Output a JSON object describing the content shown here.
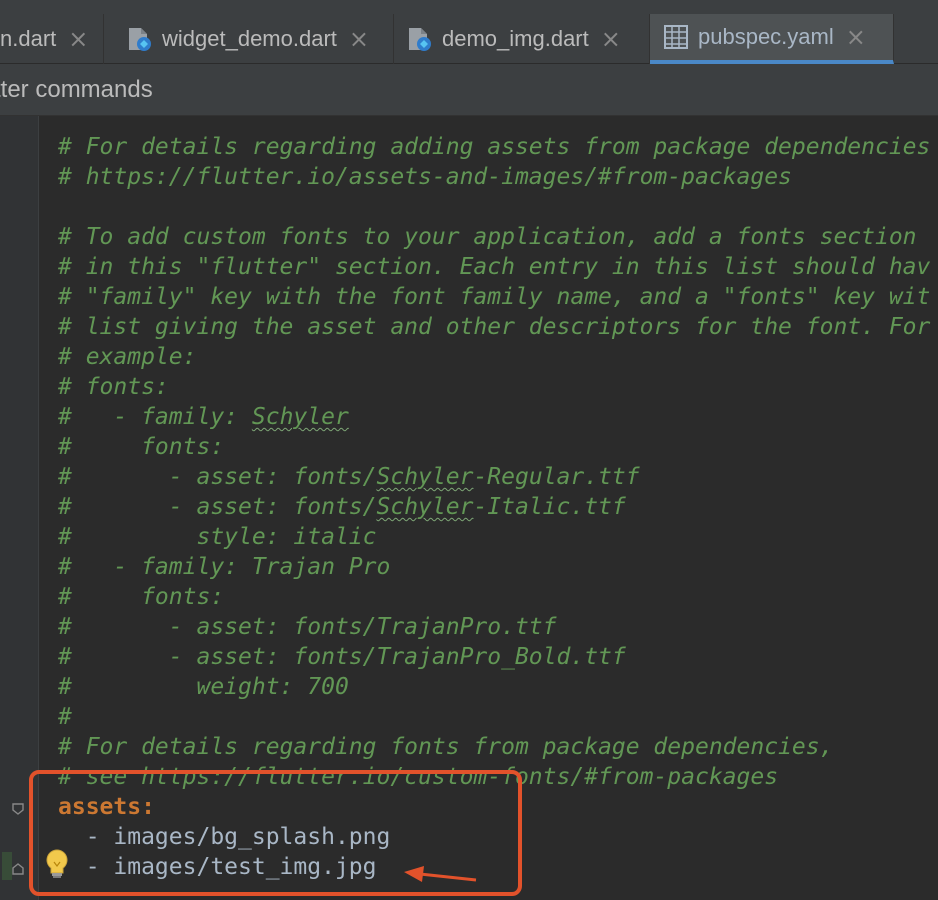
{
  "tabs": [
    {
      "label": "n.dart",
      "icon": "dart-file-icon",
      "active": false
    },
    {
      "label": "widget_demo.dart",
      "icon": "dart-file-icon",
      "active": false
    },
    {
      "label": "demo_img.dart",
      "icon": "dart-file-icon",
      "active": false
    },
    {
      "label": "pubspec.yaml",
      "icon": "yaml-table-icon",
      "active": true
    }
  ],
  "close_glyph": "×",
  "commands_bar": {
    "label": "tter commands"
  },
  "code_lines": [
    "# For details regarding adding assets from package dependencies",
    "# https://flutter.io/assets-and-images/#from-packages",
    "",
    "# To add custom fonts to your application, add a fonts section",
    "# in this \"flutter\" section. Each entry in this list should hav",
    "# \"family\" key with the font family name, and a \"fonts\" key wit",
    "# list giving the asset and other descriptors for the font. For",
    "# example:",
    "# fonts:",
    "#   - family: Schyler",
    "#     fonts:",
    "#       - asset: fonts/Schyler-Regular.ttf",
    "#       - asset: fonts/Schyler-Italic.ttf",
    "#         style: italic",
    "#   - family: Trajan Pro",
    "#     fonts:",
    "#       - asset: fonts/TrajanPro.ttf",
    "#       - asset: fonts/TrajanPro_Bold.ttf",
    "#         weight: 700",
    "#",
    "# For details regarding fonts from package dependencies,",
    "# see https://flutter.io/custom-fonts/#from-packages"
  ],
  "assets_key": "assets:",
  "asset_items": [
    "  - images/bg_splash.png",
    "  - images/test_img.jpg"
  ],
  "colors": {
    "comment": "#629755",
    "yaml_key": "#cc7832",
    "text": "#a9b7c6",
    "annotation": "#e2522b",
    "active_tab_underline": "#4a88c7"
  }
}
